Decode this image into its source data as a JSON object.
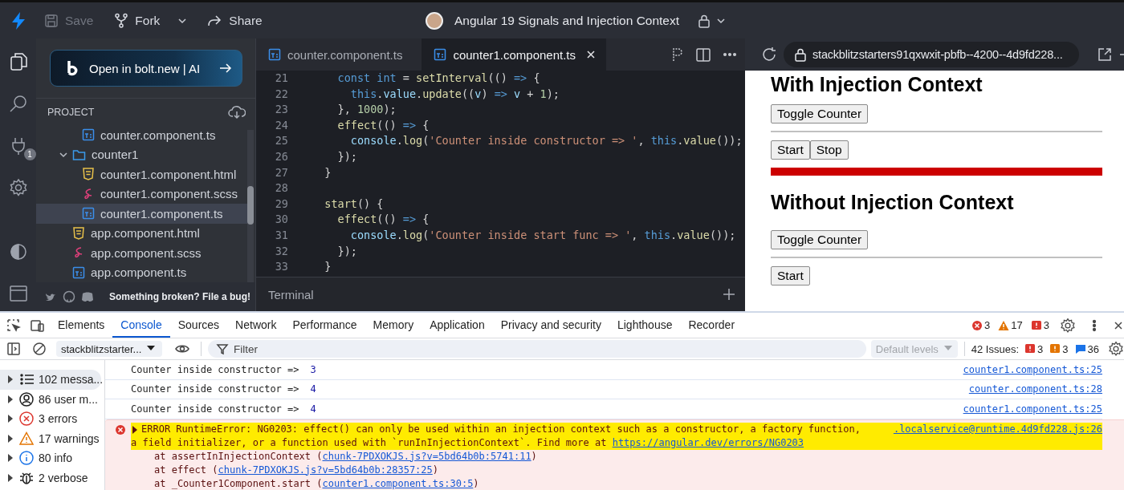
{
  "top_bar": {
    "save": {
      "label": "Save",
      "disabled": true
    },
    "fork": "Fork",
    "share": "Share",
    "project_title": "Angular 19 Signals and Injection Context"
  },
  "activity_bar": {
    "extensions_badge": "1"
  },
  "sidebar": {
    "promo_button": "Open in bolt.new | AI",
    "section_title": "PROJECT",
    "tree": [
      {
        "children": [
          {
            "name": "counter.component.ts",
            "kind": "ts",
            "selected": false
          }
        ]
      },
      {
        "name": "counter1",
        "kind": "folder",
        "expanded": true,
        "selected": false,
        "children": [
          {
            "name": "counter1.component.html",
            "kind": "html",
            "selected": false
          },
          {
            "name": "counter1.component.scss",
            "kind": "scss",
            "selected": false
          },
          {
            "name": "counter1.component.ts",
            "kind": "ts",
            "selected": true
          }
        ]
      },
      {
        "name": "app.component.html",
        "kind": "html",
        "selected": false
      },
      {
        "name": "app.component.scss",
        "kind": "scss",
        "selected": false
      },
      {
        "name": "app.component.ts",
        "kind": "ts",
        "selected": false
      }
    ],
    "footer_link": "Something broken? File a bug!"
  },
  "editor": {
    "tabs": [
      {
        "label": "counter.component.ts",
        "selected": false
      },
      {
        "label": "counter1.component.ts",
        "selected": true
      }
    ],
    "lines": [
      {
        "number": "21",
        "tokens": [
          {
            "kind": "keyword",
            "text": "    const int"
          },
          {
            "kind": "plain",
            "text": " = "
          },
          {
            "kind": "function",
            "text": "setInterval"
          },
          {
            "kind": "plain",
            "text": "(() "
          },
          {
            "kind": "keyword",
            "text": "=>"
          },
          {
            "kind": "plain",
            "text": " {"
          }
        ]
      },
      {
        "number": "22",
        "tokens": [
          {
            "kind": "keyword",
            "text": "      this"
          },
          {
            "kind": "plain",
            "text": "."
          },
          {
            "kind": "variable",
            "text": "value"
          },
          {
            "kind": "plain",
            "text": "."
          },
          {
            "kind": "function",
            "text": "update"
          },
          {
            "kind": "plain",
            "text": "(("
          },
          {
            "kind": "variable",
            "text": "v"
          },
          {
            "kind": "plain",
            "text": ") "
          },
          {
            "kind": "keyword",
            "text": "=>"
          },
          {
            "kind": "variable",
            "text": " v"
          },
          {
            "kind": "plain",
            "text": " + "
          },
          {
            "kind": "number",
            "text": "1"
          },
          {
            "kind": "plain",
            "text": ");"
          }
        ]
      },
      {
        "number": "23",
        "tokens": [
          {
            "kind": "plain",
            "text": "    }, "
          },
          {
            "kind": "number",
            "text": "1000"
          },
          {
            "kind": "plain",
            "text": ");"
          }
        ]
      },
      {
        "number": "24",
        "tokens": [
          {
            "kind": "function",
            "text": "    effect"
          },
          {
            "kind": "plain",
            "text": "(() "
          },
          {
            "kind": "keyword",
            "text": "=>"
          },
          {
            "kind": "plain",
            "text": " {"
          }
        ]
      },
      {
        "number": "25",
        "tokens": [
          {
            "kind": "variable",
            "text": "      console"
          },
          {
            "kind": "plain",
            "text": "."
          },
          {
            "kind": "function",
            "text": "log"
          },
          {
            "kind": "plain",
            "text": "("
          },
          {
            "kind": "string",
            "text": "'Counter inside constructor => '"
          },
          {
            "kind": "plain",
            "text": ", "
          },
          {
            "kind": "keyword",
            "text": "this"
          },
          {
            "kind": "plain",
            "text": "."
          },
          {
            "kind": "function",
            "text": "value"
          },
          {
            "kind": "plain",
            "text": "());"
          }
        ]
      },
      {
        "number": "26",
        "tokens": [
          {
            "kind": "plain",
            "text": "    });"
          }
        ]
      },
      {
        "number": "27",
        "tokens": [
          {
            "kind": "plain",
            "text": "  }"
          }
        ]
      },
      {
        "number": "28"
      },
      {
        "number": "29",
        "tokens": [
          {
            "kind": "function",
            "text": "  start"
          },
          {
            "kind": "plain",
            "text": "() {"
          }
        ]
      },
      {
        "number": "30",
        "tokens": [
          {
            "kind": "function",
            "text": "    effect"
          },
          {
            "kind": "plain",
            "text": "(() "
          },
          {
            "kind": "keyword",
            "text": "=>"
          },
          {
            "kind": "plain",
            "text": " {"
          }
        ]
      },
      {
        "number": "31",
        "tokens": [
          {
            "kind": "variable",
            "text": "      console"
          },
          {
            "kind": "plain",
            "text": "."
          },
          {
            "kind": "function",
            "text": "log"
          },
          {
            "kind": "plain",
            "text": "("
          },
          {
            "kind": "string",
            "text": "'Counter inside start func => '"
          },
          {
            "kind": "plain",
            "text": ", "
          },
          {
            "kind": "keyword",
            "text": "this"
          },
          {
            "kind": "plain",
            "text": "."
          },
          {
            "kind": "function",
            "text": "value"
          },
          {
            "kind": "plain",
            "text": "());"
          }
        ]
      },
      {
        "number": "32",
        "tokens": [
          {
            "kind": "plain",
            "text": "    });"
          }
        ]
      },
      {
        "number": "33",
        "tokens": [
          {
            "kind": "plain",
            "text": "  }"
          }
        ]
      }
    ],
    "terminal_label": "Terminal"
  },
  "preview": {
    "url": "stackblitzstarters91qxwxit-pbfb--4200--4d9fd228...",
    "blocks": [
      {
        "kind": "heading",
        "text": "With Injection Context"
      },
      {
        "kind": "buttons",
        "labels": [
          "Toggle Counter"
        ]
      },
      {
        "kind": "rule"
      },
      {
        "kind": "buttons",
        "labels": [
          "Start",
          "Stop"
        ]
      },
      {
        "kind": "bar"
      },
      {
        "kind": "heading",
        "text": "Without Injection Context"
      },
      {
        "kind": "buttons",
        "labels": [
          "Toggle Counter"
        ]
      },
      {
        "kind": "rule"
      },
      {
        "kind": "buttons",
        "labels": [
          "Start"
        ]
      }
    ]
  },
  "devtools": {
    "tabs": [
      {
        "label": "Elements",
        "selected": false
      },
      {
        "label": "Console",
        "selected": true
      },
      {
        "label": "Sources",
        "selected": false
      },
      {
        "label": "Network",
        "selected": false
      },
      {
        "label": "Performance",
        "selected": false
      },
      {
        "label": "Memory",
        "selected": false
      },
      {
        "label": "Application",
        "selected": false
      },
      {
        "label": "Privacy and security",
        "selected": false
      },
      {
        "label": "Lighthouse",
        "selected": false
      },
      {
        "label": "Recorder",
        "selected": false
      }
    ],
    "error_count": "3",
    "warning_count": "17",
    "issue_count": "3",
    "context": "stackblitzstarter...",
    "filter_placeholder": "Filter",
    "levels": {
      "label": "Default levels",
      "disabled": true
    },
    "issues": {
      "label": "42 Issues:",
      "counts": [
        {
          "kind": "error",
          "count": "3"
        },
        {
          "kind": "warning",
          "count": "3"
        },
        {
          "kind": "info",
          "count": "36"
        }
      ]
    }
  },
  "console": {
    "sidebar": [
      {
        "kind": "messages",
        "label": "102 messa...",
        "selected": true
      },
      {
        "kind": "user",
        "label": "86 user m...",
        "selected": false
      },
      {
        "kind": "errors",
        "label": "3 errors",
        "selected": false
      },
      {
        "kind": "warnings",
        "label": "17 warnings",
        "selected": false
      },
      {
        "kind": "info",
        "label": "80 info",
        "selected": false
      },
      {
        "kind": "verbose",
        "label": "2 verbose",
        "selected": false
      }
    ],
    "messages": [
      {
        "kind": "log",
        "text": "Counter inside constructor =>",
        "value": "3",
        "source": "counter1.component.ts:25"
      },
      {
        "kind": "log",
        "text": "Counter inside constructor =>",
        "value": "4",
        "source": "counter.component.ts:28"
      },
      {
        "kind": "log",
        "text": "Counter inside constructor =>",
        "value": "4",
        "source": "counter1.component.ts:25"
      },
      {
        "kind": "error",
        "text": "ERROR RuntimeError: NG0203: effect() can only be used within an injection context such as a constructor, a factory function, a field initializer, or a function used with `runInInjectionContext`. Find more at ",
        "link": "https://angular.dev/errors/NG0203",
        "highlighted": true,
        "expanded": false,
        "source": ".localservice@runtime.4d9fd228.js:26",
        "stack": [
          {
            "text": "at assertInInjectionContext (",
            "link": "chunk-7PDXOKJS.js?v=5bd64b0b:5741:11",
            "after": ")"
          },
          {
            "text": "at effect (",
            "link": "chunk-7PDXOKJS.js?v=5bd64b0b:28357:25",
            "after": ")"
          },
          {
            "text": "at _Counter1Component.start (",
            "link": "counter1.component.ts:30:5",
            "after": ")"
          }
        ]
      }
    ]
  }
}
